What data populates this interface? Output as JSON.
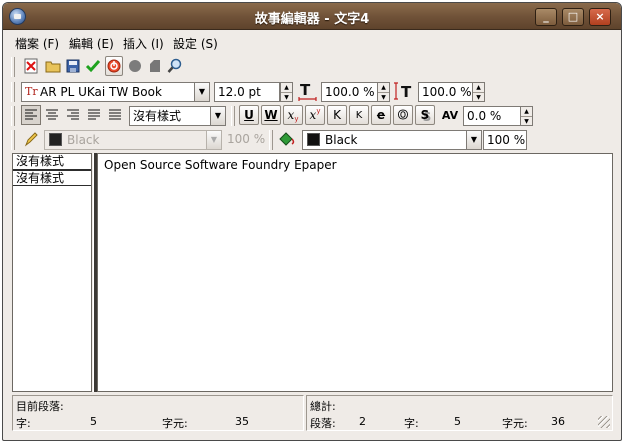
{
  "window": {
    "title": "故事編輯器 - 文字4",
    "buttons": {
      "minimize": "_",
      "maximize": "□",
      "close": "×"
    }
  },
  "menu": {
    "items": [
      {
        "label": "檔案 (F)"
      },
      {
        "label": "編輯 (E)"
      },
      {
        "label": "插入 (I)"
      },
      {
        "label": "設定 (S)"
      }
    ]
  },
  "toolbar1": {
    "icons": [
      "clear-document-icon",
      "open-folder-icon",
      "save-icon",
      "check-icon",
      "stop-icon",
      "circle-icon",
      "shape-icon",
      "zoom-icon"
    ]
  },
  "font": {
    "family": "AR PL UKai TW Book",
    "family_icon_text": "Tr",
    "size": "12.0 pt",
    "width_scale": "100.0 %",
    "height_scale": "100.0 %"
  },
  "paragraph": {
    "style": "沒有樣式",
    "tracking": "0.0 %"
  },
  "text_effects": {
    "underline": "U",
    "word_underline": "W",
    "subscript": "x",
    "superscript": "x",
    "all_caps": "K",
    "small_caps": "K",
    "strike": "e",
    "outline": "O",
    "shadow": "S",
    "kerning": "AV"
  },
  "colors": {
    "stroke_color": "Black",
    "stroke_shade": "100 %",
    "fill_color": "Black",
    "fill_shade": "100 %"
  },
  "styles_panel": {
    "rows": [
      "沒有樣式",
      "沒有樣式"
    ]
  },
  "document": {
    "text": "Open Source Software Foundry Epaper"
  },
  "status": {
    "current_paragraph_label": "目前段落:",
    "current_words_label": "字:",
    "current_words": "5",
    "current_chars_label": "字元:",
    "current_chars": "35",
    "totals_label": "總計:",
    "total_paragraphs_label": "段落:",
    "total_paragraphs": "2",
    "total_words_label": "字:",
    "total_words": "5",
    "total_chars_label": "字元:",
    "total_chars": "36"
  }
}
